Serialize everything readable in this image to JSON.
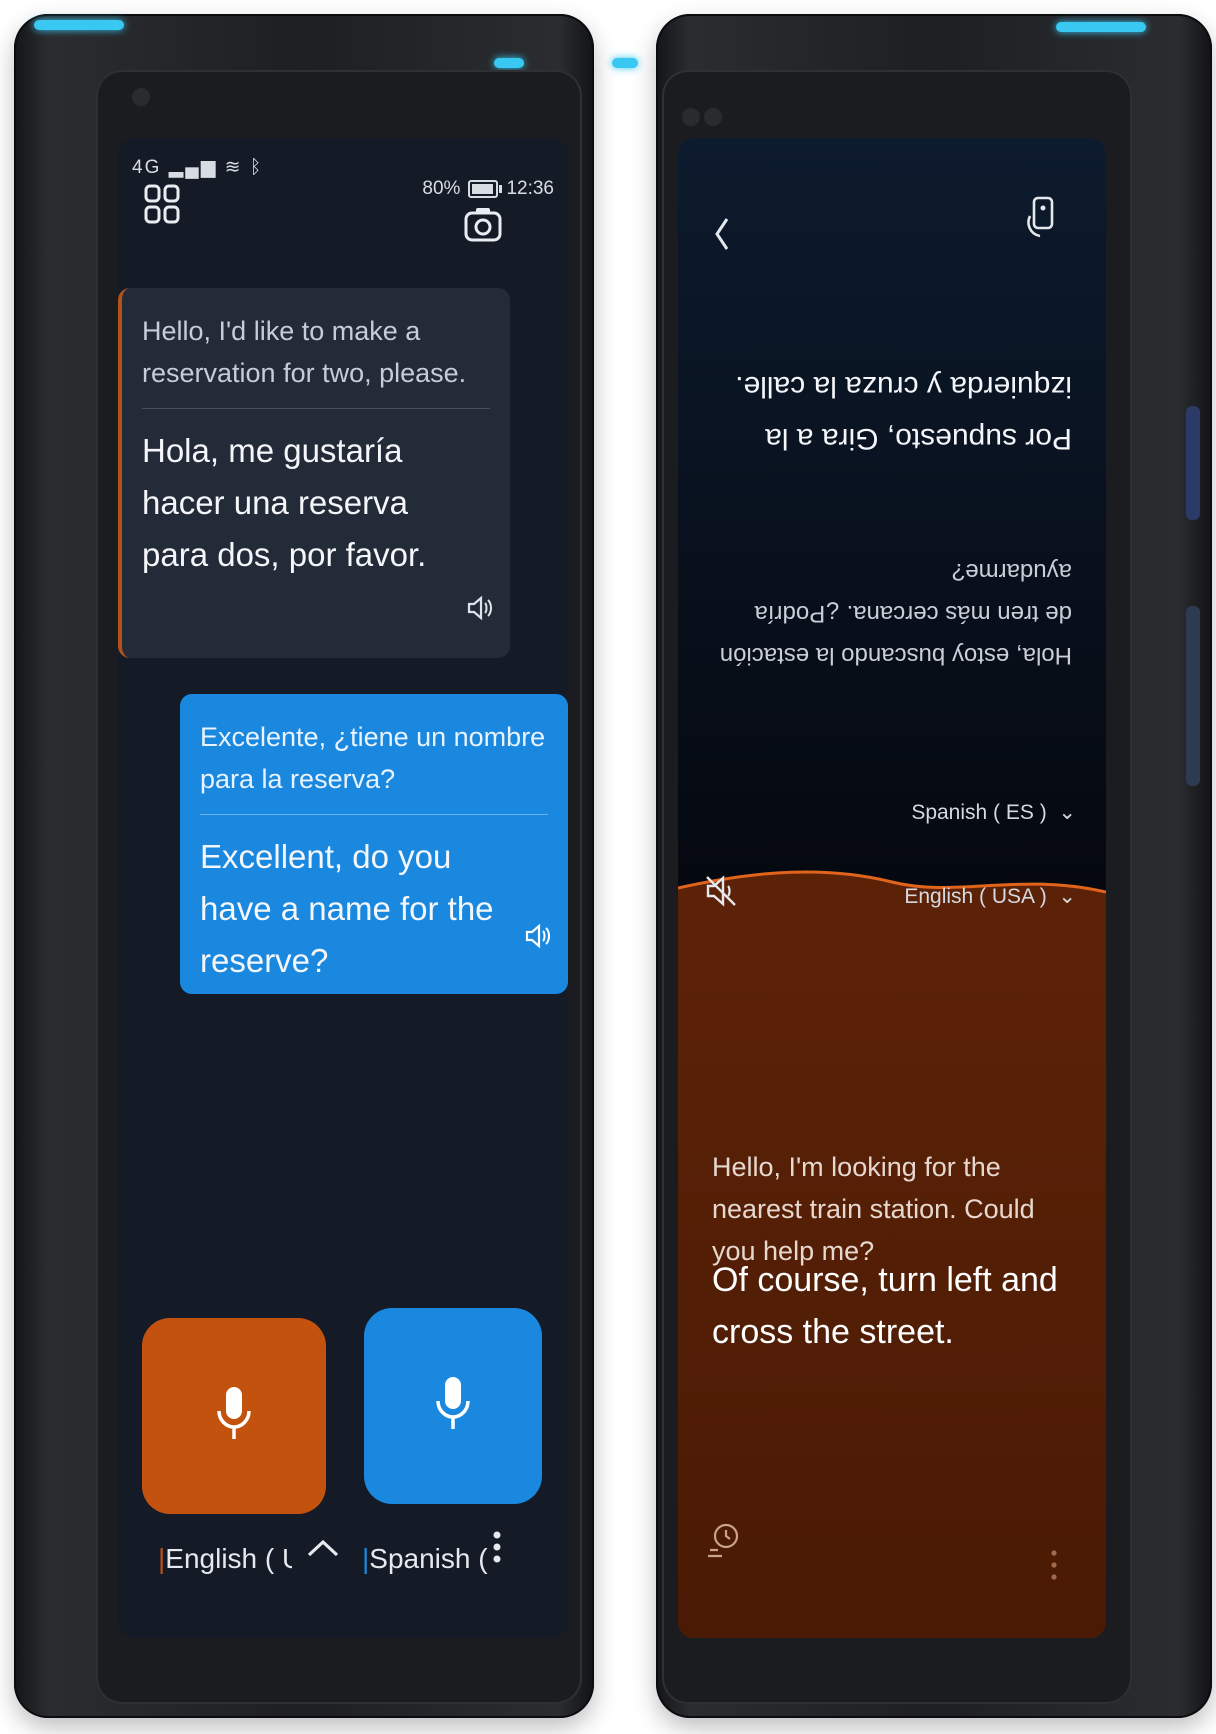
{
  "left_screen": {
    "status": {
      "signal": "4G",
      "battery": "80%",
      "time": "12:36"
    },
    "card_dark": {
      "source": "Hello, I'd like to make a reservation for two, please.",
      "translation": "Hola, me gustaría hacer una reserva para dos, por favor."
    },
    "card_blue": {
      "source": "Excelente, ¿tiene un nombre para la reserva?",
      "translation": "Excellent, do you have a name for the reserve?"
    },
    "bottom": {
      "lang_left": "English ( USA",
      "lang_right": "Spanish ( ES"
    },
    "icons": {
      "menu": "grid-icon",
      "camera": "camera-icon",
      "speaker": "speaker-icon",
      "mic": "microphone-icon",
      "chevron": "chevron-up-icon",
      "more": "more-vertical-icon"
    }
  },
  "right_screen": {
    "top": {
      "language": "Spanish ( ES )",
      "source_flipped": "Hola, estoy buscando la estación de tren más cercana. ¿Podría ayudarme?",
      "translation_flipped": "Por supuesto, Gira a la izquierda y cruza la calle."
    },
    "bottom": {
      "language": "English ( USA )",
      "source": "Hello, I'm looking for the nearest train station. Could you help me?",
      "translation": "Of course, turn left and cross the street."
    },
    "icons": {
      "back": "back-chevron-icon",
      "flip": "flip-device-icon",
      "mute": "mute-speaker-icon",
      "history": "history-icon",
      "more": "more-vertical-icon"
    }
  },
  "colors": {
    "accent_orange": "#c4520f",
    "accent_blue": "#1a88df",
    "edge_cyan": "#38c8f2"
  }
}
